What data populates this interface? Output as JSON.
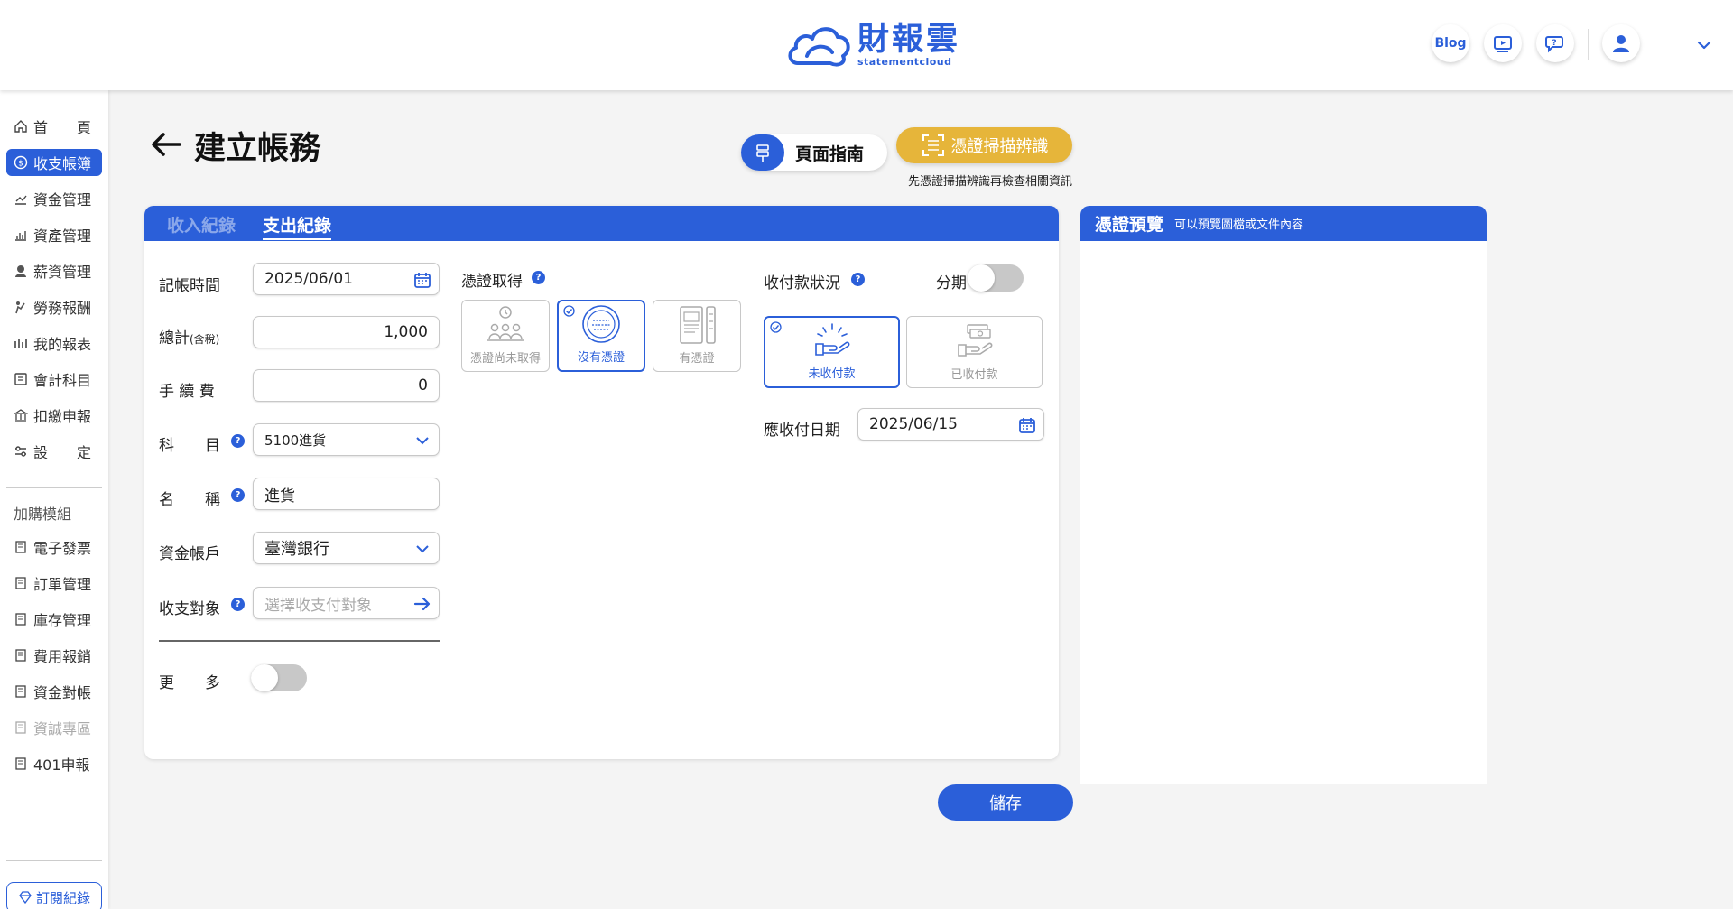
{
  "header": {
    "logo_text": "財報雲",
    "logo_sub": "statementcloud",
    "blog_label": "Blog",
    "icons": [
      "video-tutorial-icon",
      "chat-help-icon",
      "user-avatar-icon",
      "chevron-down-icon"
    ]
  },
  "sidebar": {
    "items": [
      {
        "label": "首　　頁",
        "icon": "home-icon",
        "active": false
      },
      {
        "label": "收支帳簿",
        "icon": "dollar-circle-icon",
        "active": true
      },
      {
        "label": "資金管理",
        "icon": "fund-icon",
        "active": false
      },
      {
        "label": "資產管理",
        "icon": "asset-chart-icon",
        "active": false
      },
      {
        "label": "薪資管理",
        "icon": "salary-icon",
        "active": false
      },
      {
        "label": "勞務報酬",
        "icon": "labor-icon",
        "active": false
      },
      {
        "label": "我的報表",
        "icon": "report-icon",
        "active": false
      },
      {
        "label": "會計科目",
        "icon": "ledger-icon",
        "active": false
      },
      {
        "label": "扣繳申報",
        "icon": "tax-icon",
        "active": false
      },
      {
        "label": "設　　定",
        "icon": "settings-icon",
        "active": false
      }
    ],
    "addon_section": "加購模組",
    "addons": [
      {
        "label": "電子發票",
        "dim": false
      },
      {
        "label": "訂單管理",
        "dim": false
      },
      {
        "label": "庫存管理",
        "dim": false
      },
      {
        "label": "費用報銷",
        "dim": false
      },
      {
        "label": "資金對帳",
        "dim": false
      },
      {
        "label": "資誠專區",
        "dim": true
      },
      {
        "label": "401申報",
        "dim": false
      }
    ],
    "subscription_label": "訂閱紀錄"
  },
  "page": {
    "title": "建立帳務",
    "guide_label": "頁面指南",
    "scan_label": "憑證掃描辨識",
    "scan_note": "先憑證掃描辨識再檢查相關資訊",
    "save_label": "儲存"
  },
  "tabs": [
    {
      "label": "收入紀錄",
      "active": false
    },
    {
      "label": "支出紀錄",
      "active": true
    }
  ],
  "form": {
    "date_label": "記帳時間",
    "date_value": "2025/06/01",
    "total_label": "總計",
    "total_suffix": "(含稅)",
    "total_value": "1,000",
    "fee_label": "手 續 費",
    "fee_value": "0",
    "subject_label": "科　　目",
    "subject_value": "5100進貨",
    "name_label": "名　　稱",
    "name_value": "進貨",
    "account_label": "資金帳戶",
    "account_value": "臺灣銀行",
    "target_label": "收支對象",
    "target_placeholder": "選擇收支付對象",
    "more_label": "更　　多",
    "more_toggle": false
  },
  "voucher": {
    "label": "憑證取得",
    "options": [
      {
        "label": "憑證尚未取得",
        "selected": false
      },
      {
        "label": "沒有憑證",
        "selected": true
      },
      {
        "label": "有憑證",
        "selected": false
      }
    ]
  },
  "payment": {
    "label": "收付款狀況",
    "installment_label": "分期",
    "installment_toggle": false,
    "options": [
      {
        "label": "未收付款",
        "selected": true
      },
      {
        "label": "已收付款",
        "selected": false
      }
    ],
    "due_label": "應收付日期",
    "due_value": "2025/06/15"
  },
  "preview": {
    "title": "憑證預覽",
    "subtitle": "可以預覽圖檔或文件內容"
  },
  "colors": {
    "primary": "#2b5fd9",
    "scan": "#e6b53a"
  }
}
